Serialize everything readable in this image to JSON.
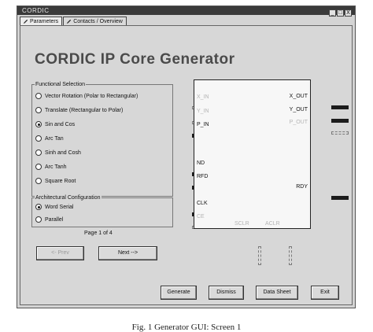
{
  "window": {
    "title": "CORDIC",
    "controls": [
      "_",
      "□",
      "X"
    ]
  },
  "tabs": [
    {
      "label": "Parameters",
      "icon": "pencil-icon",
      "active": true
    },
    {
      "label": "Contacts / Overview",
      "icon": "pencil-icon",
      "active": false
    }
  ],
  "app_title": "CORDIC IP Core Generator",
  "functional_selection": {
    "label": "Functional Selection",
    "options": [
      {
        "label": "Vector Rotation (Polar to Rectangular)",
        "selected": false
      },
      {
        "label": "Translate (Rectangular to Polar)",
        "selected": false
      },
      {
        "label": "Sin and Cos",
        "selected": true
      },
      {
        "label": "Arc Tan",
        "selected": false
      },
      {
        "label": "Sinh and Cosh",
        "selected": false
      },
      {
        "label": "Arc Tanh",
        "selected": false
      },
      {
        "label": "Square Root",
        "selected": false
      }
    ]
  },
  "architectural_configuration": {
    "label": "Architectural Configuration",
    "options": [
      {
        "label": "Word Serial",
        "selected": true
      },
      {
        "label": "Parallel",
        "selected": false
      }
    ]
  },
  "page_indicator": "Page 1 of 4",
  "nav": {
    "prev_label": "<- Prev",
    "next_label": "Next -->"
  },
  "block": {
    "inputs": {
      "x_in": "X_IN",
      "y_in": "Y_IN",
      "p_in": "P_IN",
      "nd": "ND",
      "rfd": "RFD",
      "clk": "CLK",
      "ce": "CE"
    },
    "outputs": {
      "x_out": "X_OUT",
      "y_out": "Y_OUT",
      "p_out": "P_OUT",
      "rdy": "RDY"
    },
    "bottom": {
      "sclr": "SCLR",
      "aclr": "ACLR"
    }
  },
  "actions": {
    "generate": "Generate",
    "dismiss": "Dismiss",
    "data_sheet": "Data Sheet",
    "exit": "Exit"
  },
  "caption": "Fig. 1 Generator GUI: Screen 1"
}
